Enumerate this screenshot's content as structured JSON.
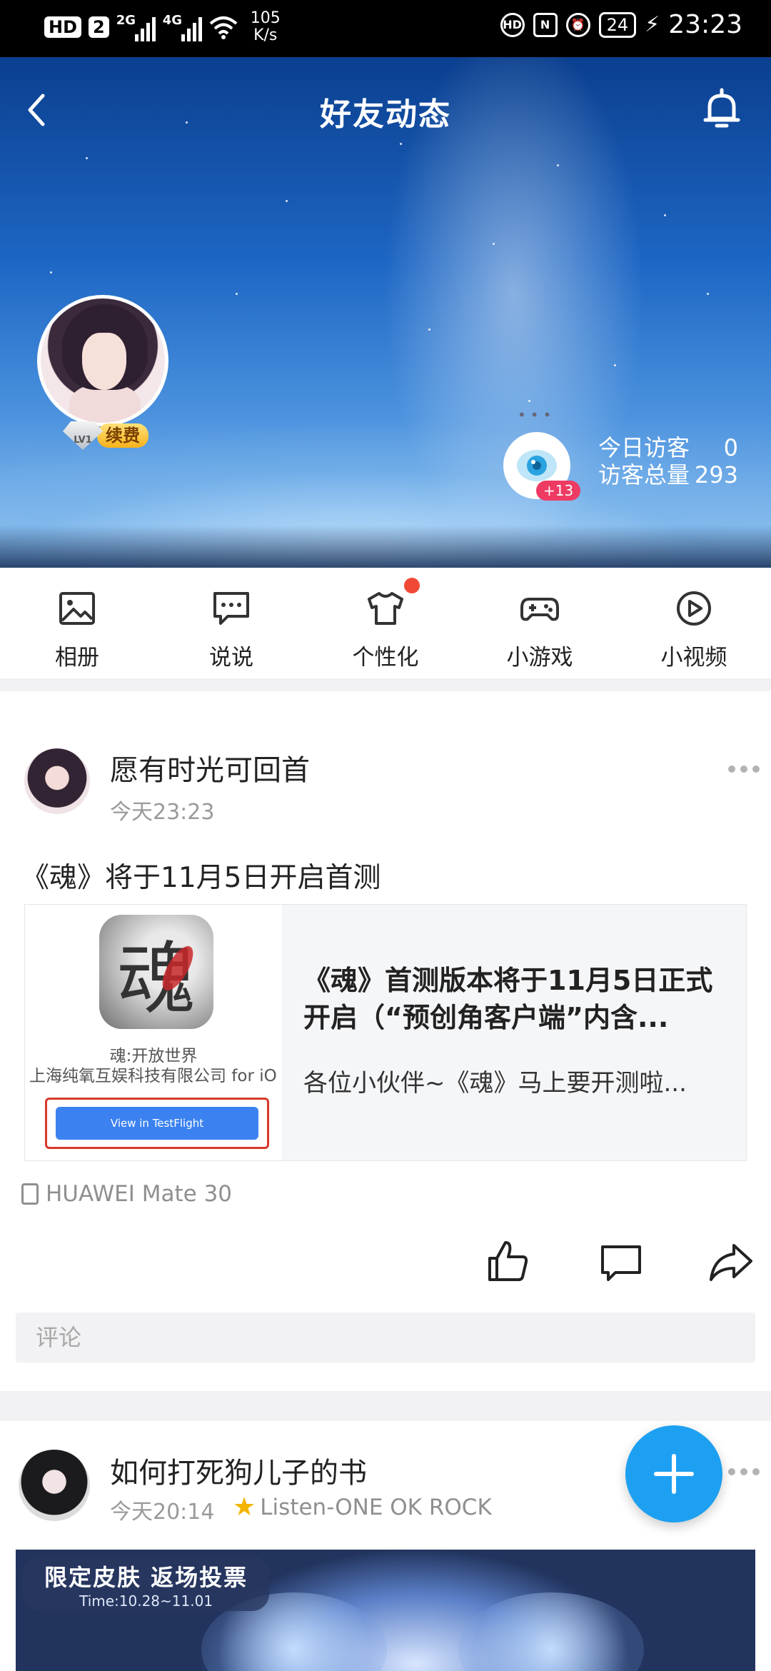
{
  "status_bar": {
    "badges": [
      "HD",
      "2"
    ],
    "net1": "2G",
    "net2": "4G",
    "speed_value": "105",
    "speed_unit": "K/s",
    "battery": "24",
    "time": "23:23"
  },
  "header": {
    "title": "好友动态"
  },
  "profile": {
    "level": "LV1",
    "renew_label": "续费",
    "visitor_badge": "+13",
    "today_visitors_label": "今日访客",
    "today_visitors_value": "0",
    "total_visitors_label": "访客总量",
    "total_visitors_value": "293"
  },
  "features": [
    {
      "label": "相册",
      "icon": "album-icon"
    },
    {
      "label": "说说",
      "icon": "message-icon"
    },
    {
      "label": "个性化",
      "icon": "tshirt-icon"
    },
    {
      "label": "小游戏",
      "icon": "gamepad-icon"
    },
    {
      "label": "小视频",
      "icon": "video-play-icon"
    }
  ],
  "post1": {
    "author": "愿有时光可回首",
    "time": "今天23:23",
    "text": "《魂》将于11月5日开启首测",
    "card": {
      "app_glyph": "魂",
      "app_name": "魂:开放世界",
      "company": "上海纯氧互娱科技有限公司 for iO",
      "testflight_button": "View in TestFlight",
      "title": "《魂》首测版本将于11月5日正式开启（“预创角客户端”内含...",
      "desc": "各位小伙伴~《魂》马上要开测啦..."
    },
    "device": "HUAWEI Mate 30",
    "comment_placeholder": "评论"
  },
  "post2": {
    "author": "如何打死狗儿子的书",
    "time": "今天20:14",
    "music": "Listen-ONE OK ROCK",
    "banner_title": "限定皮肤 返场投票",
    "banner_time": "Time:10.28~11.01"
  },
  "colors": {
    "accent": "#1da0f2",
    "red_dot": "#f04a37",
    "testflight": "#3b82f0"
  }
}
